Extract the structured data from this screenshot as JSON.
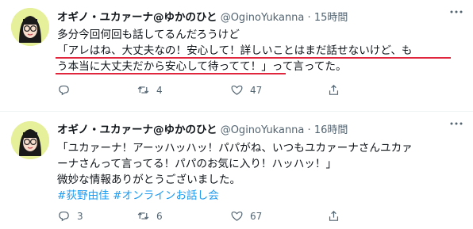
{
  "tweets": [
    {
      "author": {
        "name": "オギノ・ユカァーナ@ゆかのひと",
        "handle": "@OginoYukanna",
        "separator": "·",
        "time": "15時間"
      },
      "lines": [
        "多分今回何回も話してるんだろうけど",
        "「アレはね、大丈夫なの！安心して！詳しいことはまだ話せないけど、も",
        "う本当に大丈夫だから安心して待ってて！」って言ってた。"
      ],
      "actions": {
        "reply": "",
        "retweet": "4",
        "like": "47"
      }
    },
    {
      "author": {
        "name": "オギノ・ユカァーナ@ゆかのひと",
        "handle": "@OginoYukanna",
        "separator": "·",
        "time": "16時間"
      },
      "lines": [
        "「ユカァーナ！アーッハッハッ！パパがね、いつもユカァーナさんユカァ",
        "ーナさんって言ってる！パパのお気に入り！ハッハッ！」",
        "微妙な情報ありがとうございました。"
      ],
      "hashtags": [
        "#荻野由佳",
        "#オンラインお話し会"
      ],
      "actions": {
        "reply": "3",
        "retweet": "6",
        "like": "67"
      }
    }
  ],
  "icons": [
    "reply-icon",
    "retweet-icon",
    "like-icon",
    "share-icon",
    "more-icon"
  ],
  "colors": {
    "accent": "#1d9bf0",
    "underline": "#e0263c",
    "muted": "#536471",
    "avatar_bg": "#e6ef9a"
  }
}
